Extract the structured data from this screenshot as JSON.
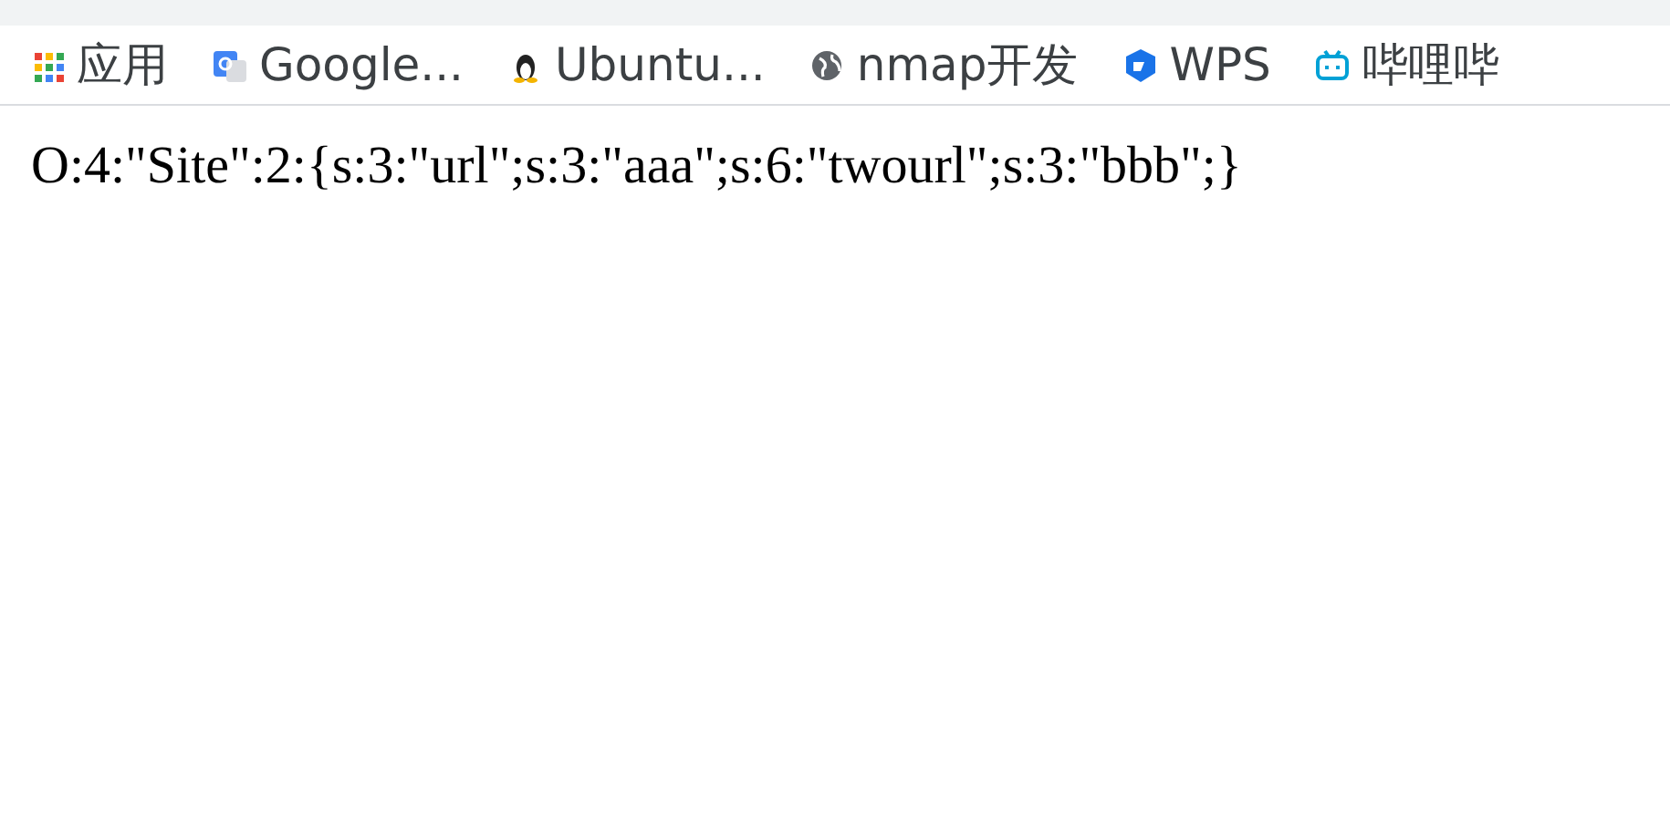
{
  "bookmarks": [
    {
      "kind": "apps",
      "label": "应用"
    },
    {
      "kind": "translate",
      "label": "Google..."
    },
    {
      "kind": "penguin",
      "label": "Ubuntu..."
    },
    {
      "kind": "globe",
      "label": "nmap开发"
    },
    {
      "kind": "cube",
      "label": "WPS"
    },
    {
      "kind": "tv",
      "label": "哔哩哔"
    }
  ],
  "page_text": "O:4:\"Site\":2:{s:3:\"url\";s:3:\"aaa\";s:6:\"twourl\";s:3:\"bbb\";}"
}
